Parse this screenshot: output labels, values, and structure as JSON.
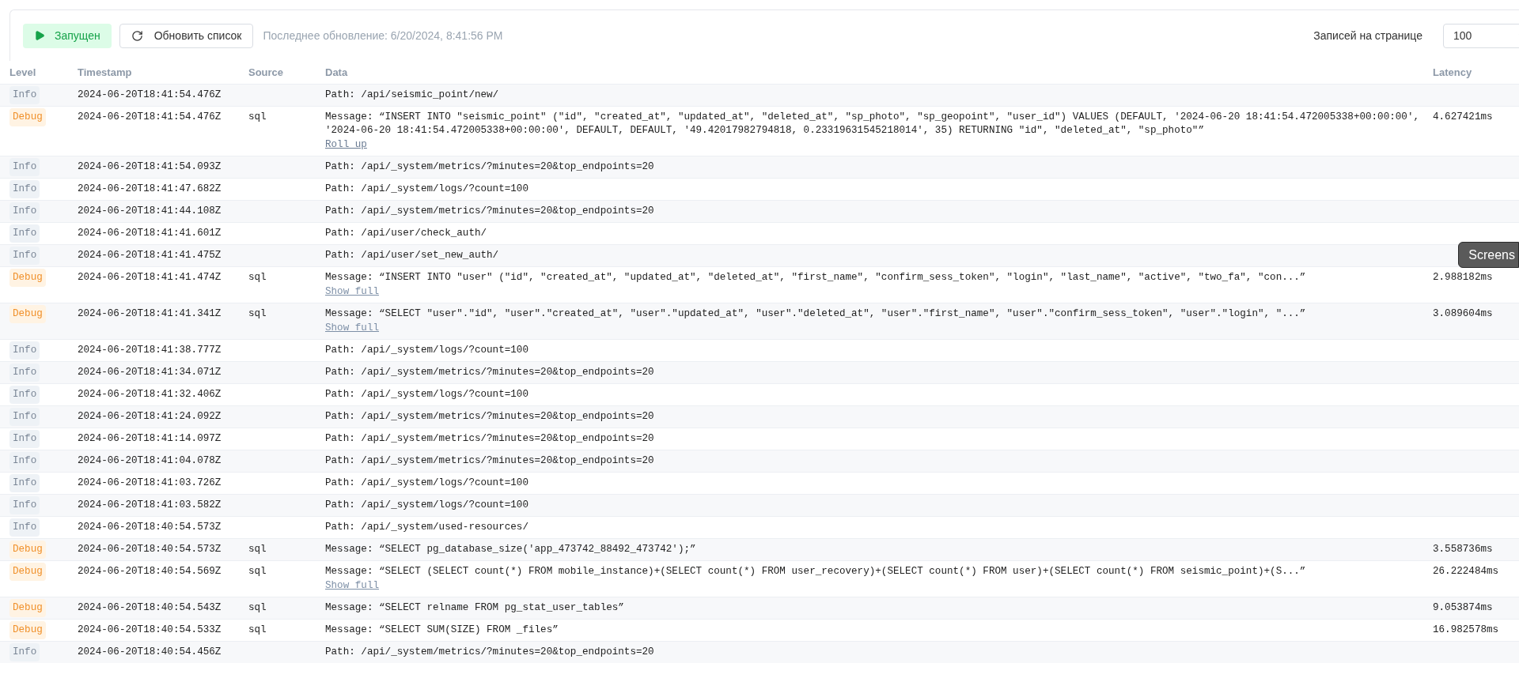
{
  "toolbar": {
    "status": {
      "label": "Запущен",
      "running": true
    },
    "refresh": {
      "label": "Обновить список"
    },
    "last_update": "Последнее обновление: 6/20/2024, 8:41:56 PM",
    "page_size_label": "Записей на странице",
    "page_size": "100"
  },
  "table": {
    "columns": [
      "Level",
      "Timestamp",
      "Source",
      "Data",
      "Latency"
    ],
    "rows": [
      {
        "level": "Info",
        "kind": "info",
        "timestamp": "2024-06-20T18:41:54.476Z",
        "source": "",
        "data": "Path: /api/seismic_point/new/",
        "latency": ""
      },
      {
        "level": "Debug",
        "kind": "debug",
        "timestamp": "2024-06-20T18:41:54.476Z",
        "source": "sql",
        "data": "Message: “INSERT INTO \"seismic_point\" (\"id\", \"created_at\", \"updated_at\", \"deleted_at\", \"sp_photo\", \"sp_geopoint\", \"user_id\") VALUES (DEFAULT, '2024-06-20 18:41:54.472005338+00:00:00', '2024-06-20 18:41:54.472005338+00:00:00', DEFAULT, DEFAULT, '49.42017982794818, 0.23319631545218014', 35) RETURNING \"id\", \"deleted_at\", \"sp_photo\"”",
        "toggle": "Roll up",
        "expanded": true,
        "latency": "4.627421ms"
      },
      {
        "level": "Info",
        "kind": "info",
        "timestamp": "2024-06-20T18:41:54.093Z",
        "source": "",
        "data": "Path: /api/_system/metrics/?minutes=20&top_endpoints=20",
        "latency": ""
      },
      {
        "level": "Info",
        "kind": "info",
        "timestamp": "2024-06-20T18:41:47.682Z",
        "source": "",
        "data": "Path: /api/_system/logs/?count=100",
        "latency": ""
      },
      {
        "level": "Info",
        "kind": "info",
        "timestamp": "2024-06-20T18:41:44.108Z",
        "source": "",
        "data": "Path: /api/_system/metrics/?minutes=20&top_endpoints=20",
        "latency": ""
      },
      {
        "level": "Info",
        "kind": "info",
        "timestamp": "2024-06-20T18:41:41.601Z",
        "source": "",
        "data": "Path: /api/user/check_auth/",
        "latency": ""
      },
      {
        "level": "Info",
        "kind": "info",
        "timestamp": "2024-06-20T18:41:41.475Z",
        "source": "",
        "data": "Path: /api/user/set_new_auth/",
        "latency": ""
      },
      {
        "level": "Debug",
        "kind": "debug",
        "timestamp": "2024-06-20T18:41:41.474Z",
        "source": "sql",
        "data": "Message: “INSERT INTO \"user\" (\"id\", \"created_at\", \"updated_at\", \"deleted_at\", \"first_name\", \"confirm_sess_token\", \"login\", \"last_name\", \"active\", \"two_fa\", \"con...”",
        "toggle": "Show full",
        "expanded": false,
        "latency": "2.988182ms"
      },
      {
        "level": "Debug",
        "kind": "debug",
        "timestamp": "2024-06-20T18:41:41.341Z",
        "source": "sql",
        "data": "Message: “SELECT \"user\".\"id\", \"user\".\"created_at\", \"user\".\"updated_at\", \"user\".\"deleted_at\", \"user\".\"first_name\", \"user\".\"confirm_sess_token\", \"user\".\"login\", \"...”",
        "toggle": "Show full",
        "expanded": false,
        "latency": "3.089604ms"
      },
      {
        "level": "Info",
        "kind": "info",
        "timestamp": "2024-06-20T18:41:38.777Z",
        "source": "",
        "data": "Path: /api/_system/logs/?count=100",
        "latency": ""
      },
      {
        "level": "Info",
        "kind": "info",
        "timestamp": "2024-06-20T18:41:34.071Z",
        "source": "",
        "data": "Path: /api/_system/metrics/?minutes=20&top_endpoints=20",
        "latency": ""
      },
      {
        "level": "Info",
        "kind": "info",
        "timestamp": "2024-06-20T18:41:32.406Z",
        "source": "",
        "data": "Path: /api/_system/logs/?count=100",
        "latency": ""
      },
      {
        "level": "Info",
        "kind": "info",
        "timestamp": "2024-06-20T18:41:24.092Z",
        "source": "",
        "data": "Path: /api/_system/metrics/?minutes=20&top_endpoints=20",
        "latency": ""
      },
      {
        "level": "Info",
        "kind": "info",
        "timestamp": "2024-06-20T18:41:14.097Z",
        "source": "",
        "data": "Path: /api/_system/metrics/?minutes=20&top_endpoints=20",
        "latency": ""
      },
      {
        "level": "Info",
        "kind": "info",
        "timestamp": "2024-06-20T18:41:04.078Z",
        "source": "",
        "data": "Path: /api/_system/metrics/?minutes=20&top_endpoints=20",
        "latency": ""
      },
      {
        "level": "Info",
        "kind": "info",
        "timestamp": "2024-06-20T18:41:03.726Z",
        "source": "",
        "data": "Path: /api/_system/logs/?count=100",
        "latency": ""
      },
      {
        "level": "Info",
        "kind": "info",
        "timestamp": "2024-06-20T18:41:03.582Z",
        "source": "",
        "data": "Path: /api/_system/logs/?count=100",
        "latency": ""
      },
      {
        "level": "Info",
        "kind": "info",
        "timestamp": "2024-06-20T18:40:54.573Z",
        "source": "",
        "data": "Path: /api/_system/used-resources/",
        "latency": ""
      },
      {
        "level": "Debug",
        "kind": "debug",
        "timestamp": "2024-06-20T18:40:54.573Z",
        "source": "sql",
        "data": "Message: “SELECT pg_database_size('app_473742_88492_473742');”",
        "latency": "3.558736ms"
      },
      {
        "level": "Debug",
        "kind": "debug",
        "timestamp": "2024-06-20T18:40:54.569Z",
        "source": "sql",
        "data": "Message: “SELECT (SELECT count(*) FROM mobile_instance)+(SELECT count(*) FROM user_recovery)+(SELECT count(*) FROM user)+(SELECT count(*) FROM seismic_point)+(S...”",
        "toggle": "Show full",
        "expanded": false,
        "latency": "26.222484ms"
      },
      {
        "level": "Debug",
        "kind": "debug",
        "timestamp": "2024-06-20T18:40:54.543Z",
        "source": "sql",
        "data": "Message: “SELECT relname FROM pg_stat_user_tables”",
        "latency": "9.053874ms"
      },
      {
        "level": "Debug",
        "kind": "debug",
        "timestamp": "2024-06-20T18:40:54.533Z",
        "source": "sql",
        "data": "Message: “SELECT SUM(SIZE) FROM _files”",
        "latency": "16.982578ms"
      },
      {
        "level": "Info",
        "kind": "info",
        "timestamp": "2024-06-20T18:40:54.456Z",
        "source": "",
        "data": "Path: /api/_system/metrics/?minutes=20&top_endpoints=20",
        "latency": ""
      }
    ]
  },
  "tooltip": "Screens"
}
